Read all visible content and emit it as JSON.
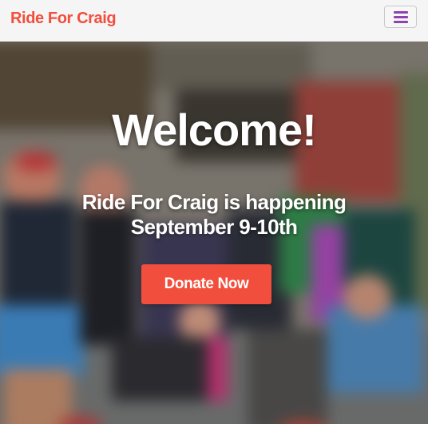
{
  "navbar": {
    "brand": "Ride For Craig",
    "menu_icon": "hamburger-menu-icon"
  },
  "hero": {
    "title": "Welcome!",
    "subtitle": "Ride For Craig is happening September 9-10th",
    "cta_label": "Donate Now"
  },
  "colors": {
    "brand": "#f24e3d",
    "menu_icon": "#8e44ad",
    "cta_background": "#f24e3d",
    "navbar_background": "#f5f5f5"
  }
}
